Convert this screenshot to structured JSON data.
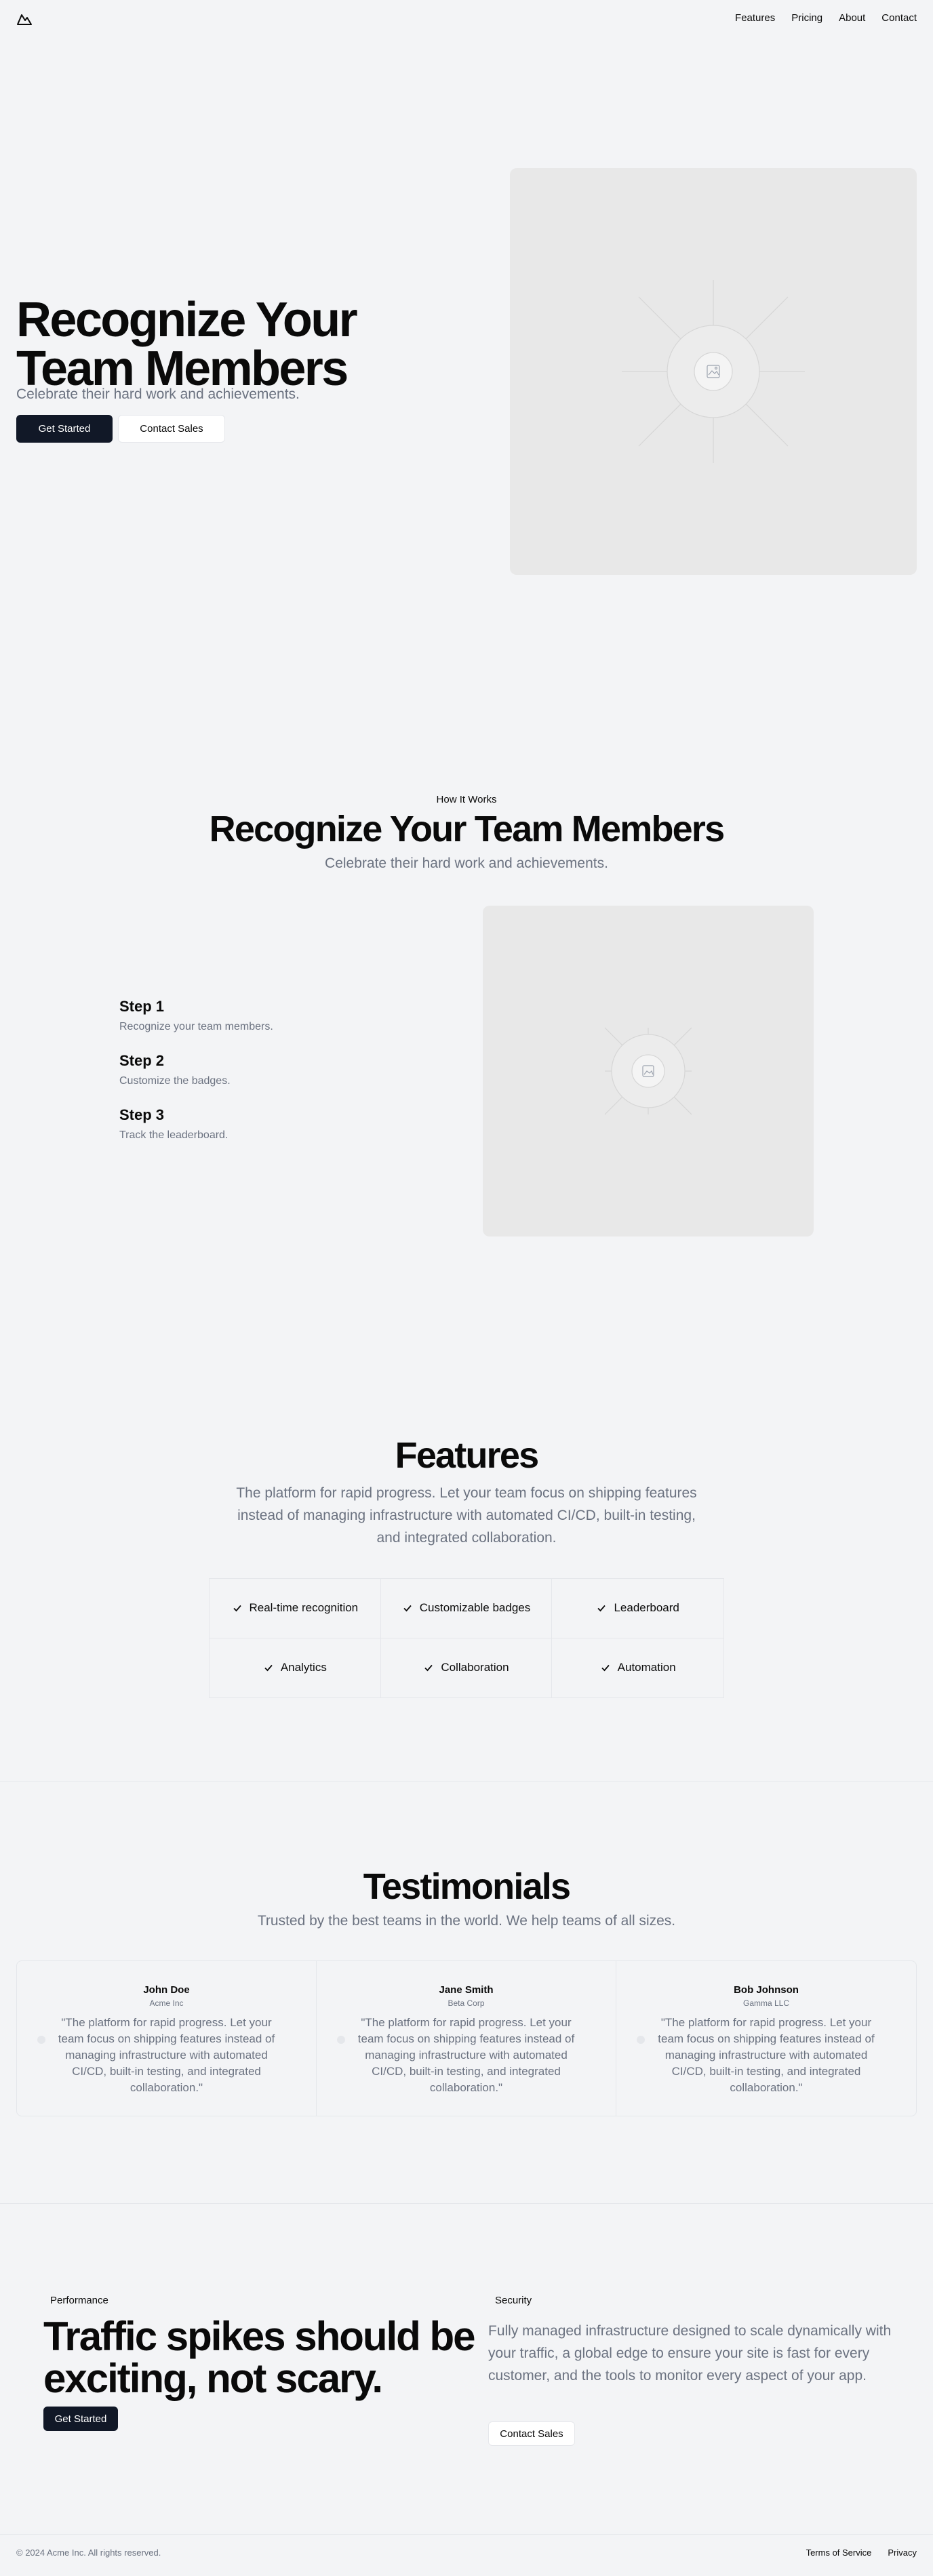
{
  "nav": {
    "items": [
      "Features",
      "Pricing",
      "About",
      "Contact"
    ]
  },
  "hero": {
    "title": "Recognize Your Team Members",
    "subtitle": "Celebrate their hard work and achievements.",
    "primary_cta": "Get Started",
    "secondary_cta": "Contact Sales"
  },
  "how_it_works": {
    "eyebrow": "How It Works",
    "title": "Recognize Your Team Members",
    "subtitle": "Celebrate their hard work and achievements.",
    "steps": [
      {
        "title": "Step 1",
        "text": "Recognize your team members."
      },
      {
        "title": "Step 2",
        "text": "Customize the badges."
      },
      {
        "title": "Step 3",
        "text": "Track the leaderboard."
      }
    ]
  },
  "features": {
    "title": "Features",
    "subtitle": "The platform for rapid progress. Let your team focus on shipping features instead of managing infrastructure with automated CI/CD, built-in testing, and integrated collaboration.",
    "items": [
      "Real-time recognition",
      "Customizable badges",
      "Leaderboard",
      "Analytics",
      "Collaboration",
      "Automation"
    ]
  },
  "testimonials": {
    "title": "Testimonials",
    "subtitle": "Trusted by the best teams in the world. We help teams of all sizes.",
    "items": [
      {
        "name": "John Doe",
        "company": "Acme Inc",
        "quote": "\"The platform for rapid progress. Let your team focus on shipping features instead of managing infrastructure with automated CI/CD, built-in testing, and integrated collaboration.\""
      },
      {
        "name": "Jane Smith",
        "company": "Beta Corp",
        "quote": "\"The platform for rapid progress. Let your team focus on shipping features instead of managing infrastructure with automated CI/CD, built-in testing, and integrated collaboration.\""
      },
      {
        "name": "Bob Johnson",
        "company": "Gamma LLC",
        "quote": "\"The platform for rapid progress. Let your team focus on shipping features instead of managing infrastructure with automated CI/CD, built-in testing, and integrated collaboration.\""
      }
    ]
  },
  "performance": {
    "badge": "Performance",
    "title": "Traffic spikes should be exciting, not scary.",
    "cta": "Get Started"
  },
  "security": {
    "badge": "Security",
    "text": "Fully managed infrastructure designed to scale dynamically with your traffic, a global edge to ensure your site is fast for every customer, and the tools to monitor every aspect of your app.",
    "cta": "Contact Sales"
  },
  "footer": {
    "copyright": "© 2024 Acme Inc. All rights reserved.",
    "links": [
      "Terms of Service",
      "Privacy"
    ]
  },
  "icons": {
    "logo": "mountain-icon",
    "placeholder": "image-icon",
    "check": "check-icon"
  },
  "colors": {
    "primary_button": "#111827",
    "background": "#f3f4f6",
    "muted_text": "#6b7280",
    "border": "#e5e7eb"
  }
}
